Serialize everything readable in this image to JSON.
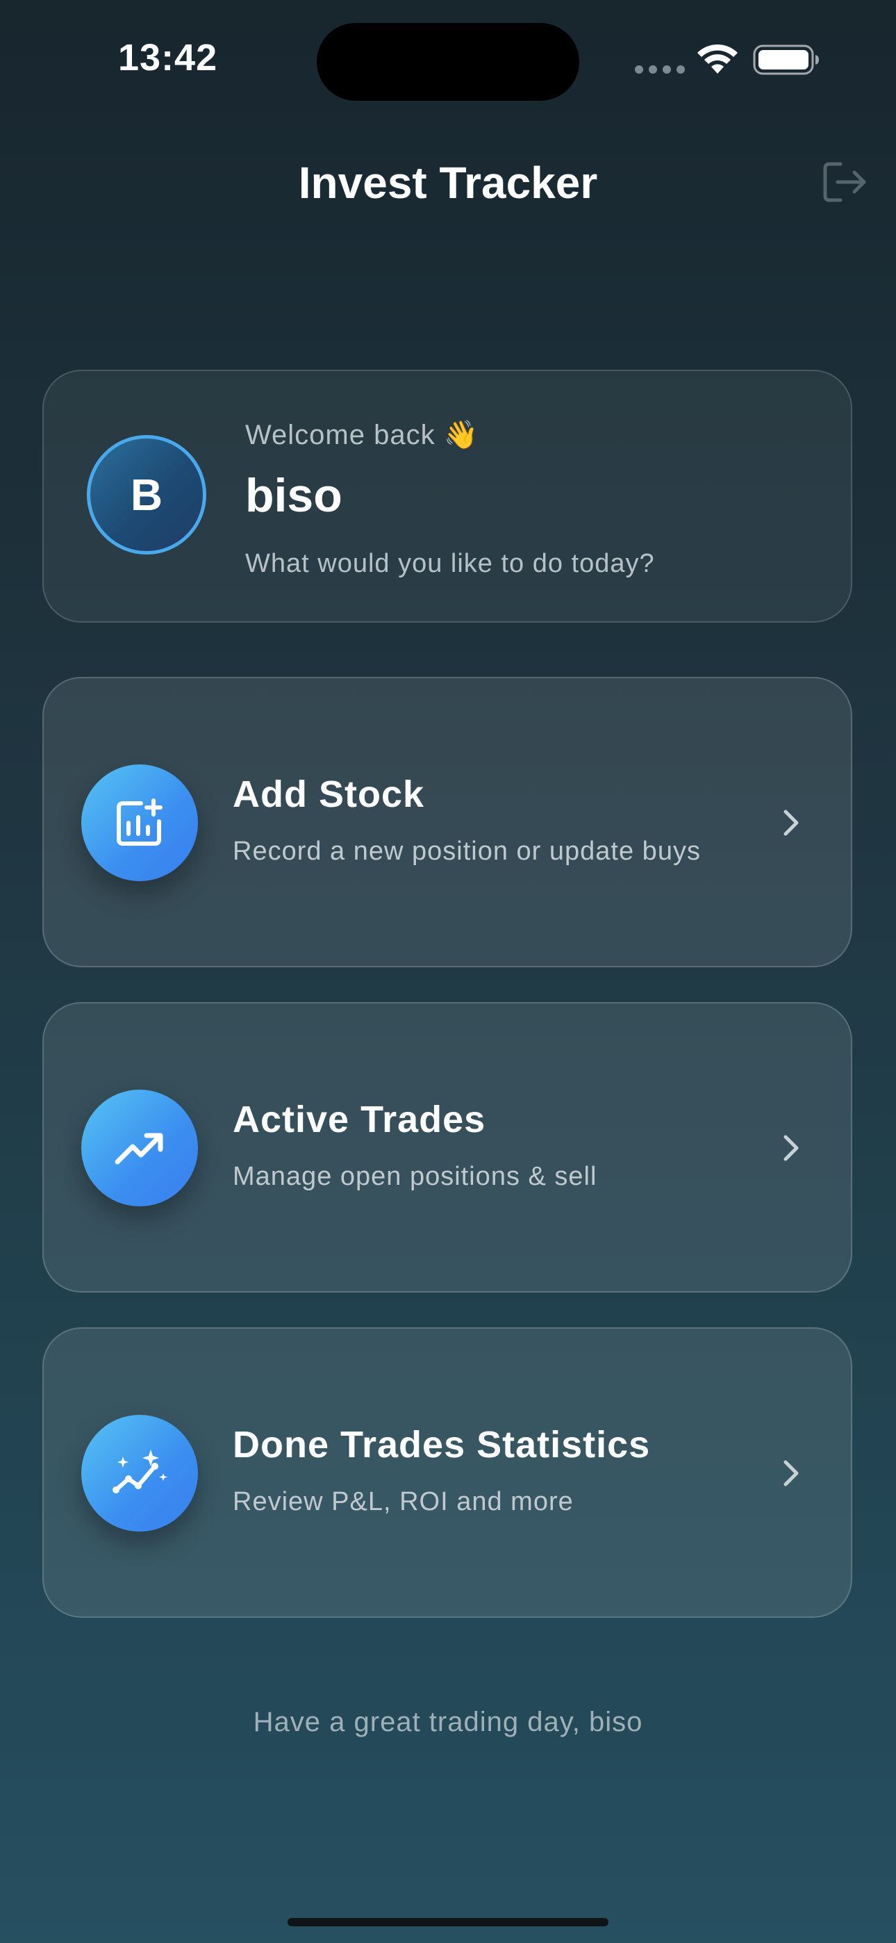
{
  "status_bar": {
    "time": "13:42"
  },
  "header": {
    "title": "Invest Tracker",
    "logout_icon": "logout-icon"
  },
  "welcome": {
    "greeting": "Welcome back 👋",
    "avatar_initial": "B",
    "username": "biso",
    "subtitle": "What would you like to do today?"
  },
  "actions": [
    {
      "title": "Add Stock",
      "subtitle": "Record a new position or update buys",
      "icon": "add-chart-icon"
    },
    {
      "title": "Active Trades",
      "subtitle": "Manage open positions & sell",
      "icon": "trending-up-icon"
    },
    {
      "title": "Done Trades Statistics",
      "subtitle": "Review P&L, ROI and more",
      "icon": "sparkle-chart-icon"
    }
  ],
  "footer": {
    "message": "Have a great trading day, biso"
  },
  "colors": {
    "accent_blue": "#3b8ef0",
    "accent_cyan": "#55c4f2",
    "avatar_ring": "#4aa9ec"
  }
}
